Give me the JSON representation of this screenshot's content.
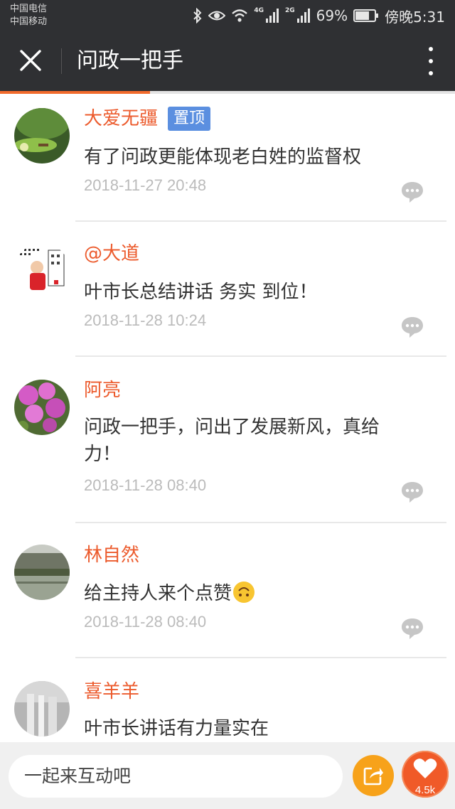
{
  "status_bar": {
    "carrier_1": "中国电信",
    "carrier_2": "中国移动",
    "network_1": "4G",
    "network_2": "2G",
    "battery": "69%",
    "time": "傍晚5:31"
  },
  "header": {
    "title": "问政一把手",
    "close_icon": "close-icon",
    "more_icon": "more-vertical-icon",
    "load_progress": 0.33
  },
  "comments": [
    {
      "name": "大爱无疆",
      "badge": "置顶",
      "text": "有了问政更能体现老白姓的监督权",
      "time": "2018-11-27 20:48"
    },
    {
      "name": "@大道",
      "text": "叶市长总结讲话 务实 到位！",
      "time": "2018-11-28 10:24"
    },
    {
      "name": "阿亮",
      "text": "问政一把手，问出了发展新风，真给力！",
      "time": "2018-11-28 08:40"
    },
    {
      "name": "林自然",
      "text": "给主持人来个点赞",
      "time": "2018-11-28 08:40"
    },
    {
      "name": "喜羊羊",
      "text": "叶市长讲话有力量实在"
    }
  ],
  "bottom_bar": {
    "input_placeholder": "一起来互动吧",
    "like_count": "4.5k"
  },
  "colors": {
    "accent": "#f26b2c",
    "name": "#ec5b2d",
    "pin_badge": "#5b8fe0",
    "share": "#f7a21a"
  }
}
